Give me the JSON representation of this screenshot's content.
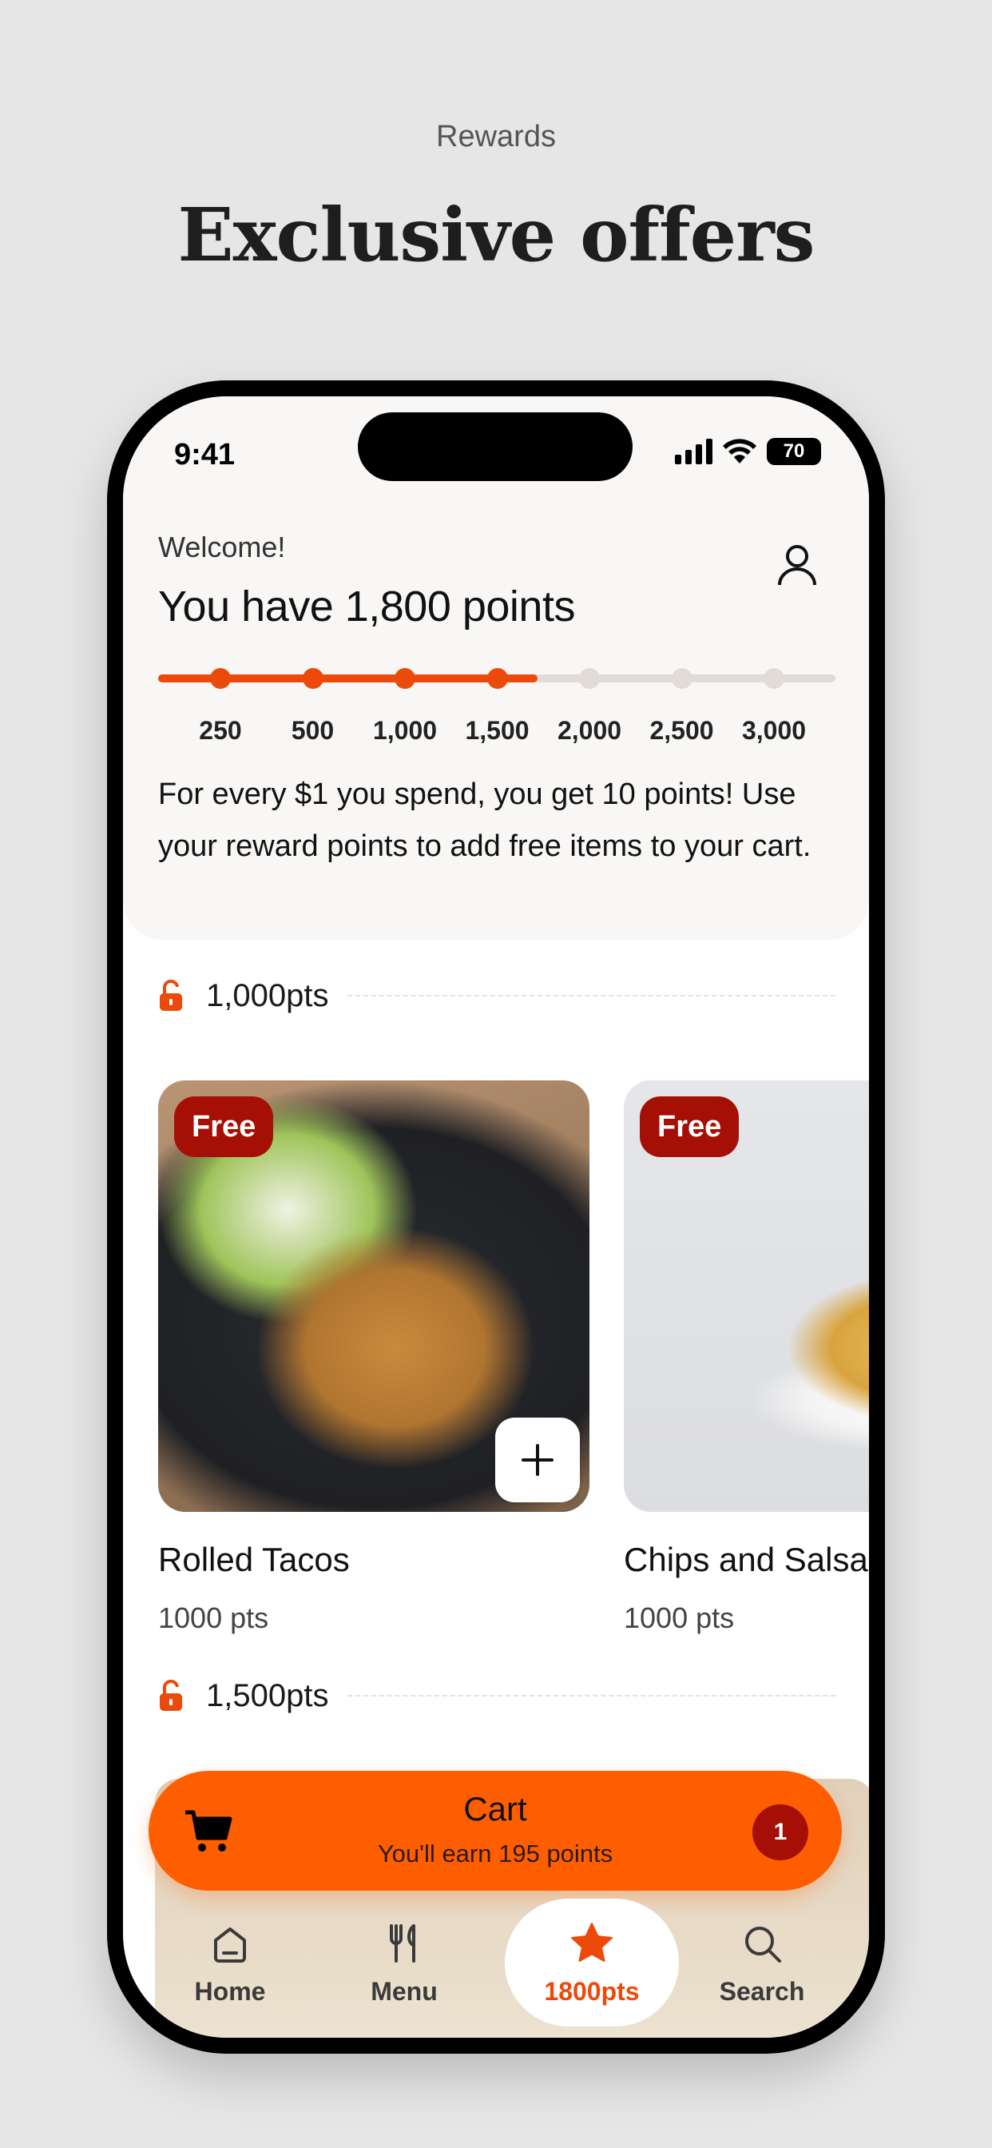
{
  "page": {
    "caption": "Rewards",
    "title": "Exclusive offers"
  },
  "status_bar": {
    "time": "9:41",
    "battery": "70"
  },
  "header": {
    "welcome": "Welcome!",
    "points_heading": "You have 1,800 points",
    "info_text": "For every $1 you spend, you get 10 points! Use your reward points to add free items to your cart."
  },
  "progress": {
    "current_points": 1800,
    "milestones": [
      "250",
      "500",
      "1,000",
      "1,500",
      "2,000",
      "2,500",
      "3,000"
    ],
    "fill_fraction": 0.56
  },
  "tiers": [
    {
      "label": "1,000pts",
      "rewards": [
        {
          "badge": "Free",
          "name": "Rolled Tacos",
          "points": "1000 pts"
        },
        {
          "badge": "Free",
          "name": "Chips and Salsa",
          "points": "1000 pts"
        }
      ]
    },
    {
      "label": "1,500pts"
    }
  ],
  "cart": {
    "title": "Cart",
    "subtitle": "You'll earn 195 points",
    "count": "1"
  },
  "tab_bar": {
    "items": [
      {
        "label": "Home",
        "icon": "home-icon"
      },
      {
        "label": "Menu",
        "icon": "utensils-icon"
      },
      {
        "label": "1800pts",
        "icon": "star-icon",
        "active": true
      },
      {
        "label": "Search",
        "icon": "search-icon"
      }
    ]
  },
  "colors": {
    "accent": "#ec4a0b",
    "cart": "#ff5e00",
    "badge": "#a50f05"
  }
}
